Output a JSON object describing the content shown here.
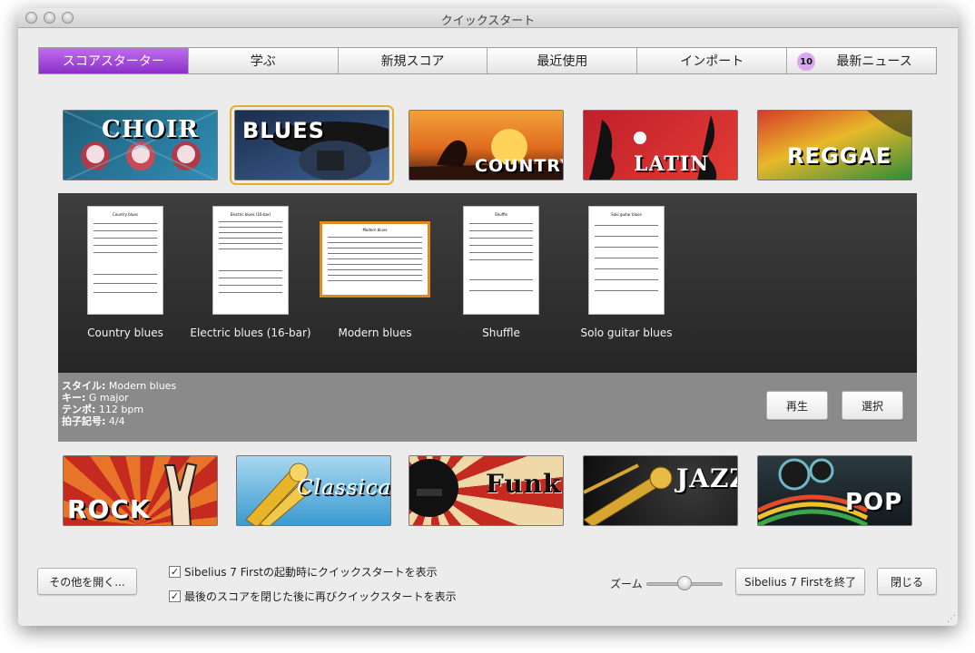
{
  "window": {
    "title": "クイックスタート"
  },
  "tabs": [
    {
      "label": "スコアスターター"
    },
    {
      "label": "学ぶ"
    },
    {
      "label": "新規スコア"
    },
    {
      "label": "最近使用"
    },
    {
      "label": "インポート"
    },
    {
      "label": "最新ニュース",
      "badge": "10"
    }
  ],
  "genres_top": [
    "CHOIR",
    "BLUES",
    "COUNTRY",
    "LATIN",
    "REGGAE"
  ],
  "genres_bottom": [
    "ROCK",
    "Classical",
    "Funk",
    "JAZZ",
    "POP"
  ],
  "templates": [
    {
      "caption": "Country blues",
      "sheet_title": "Country blues"
    },
    {
      "caption": "Electric blues (16-bar)",
      "sheet_title": "Electric blues (16-bar)"
    },
    {
      "caption": "Modern blues",
      "sheet_title": "Modern blues"
    },
    {
      "caption": "Shuffle",
      "sheet_title": "Shuffle"
    },
    {
      "caption": "Solo guitar blues",
      "sheet_title": "Solo guitar blues"
    }
  ],
  "selected_template": "Modern blues",
  "info": {
    "style_label": "スタイル:",
    "style_value": "Modern blues",
    "key_label": "キー:",
    "key_value": "G major",
    "tempo_label": "テンポ:",
    "tempo_value": "112 bpm",
    "time_label": "拍子記号:",
    "time_value": "4/4"
  },
  "buttons": {
    "play": "再生",
    "select": "選択",
    "open_other": "その他を開く...",
    "quit": "Sibelius 7 Firstを終了",
    "close": "閉じる"
  },
  "checkboxes": [
    {
      "label": "Sibelius 7 Firstの起動時にクイックスタートを表示",
      "checked": true
    },
    {
      "label": "最後のスコアを閉じた後に再びクイックスタートを表示",
      "checked": true
    }
  ],
  "zoom": {
    "label": "ズーム",
    "level": 0.5
  }
}
